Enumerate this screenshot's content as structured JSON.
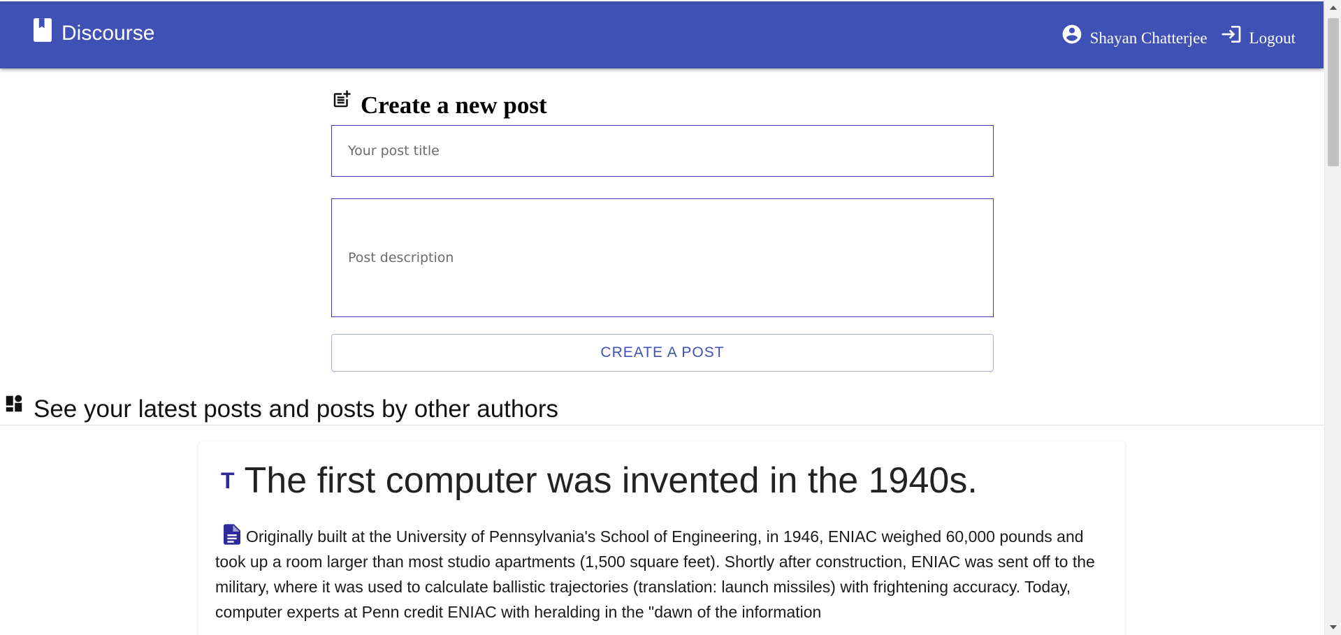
{
  "app": {
    "title": "Discourse"
  },
  "nav": {
    "user_name": "Shayan Chatterjee",
    "logout_label": "Logout"
  },
  "create_post": {
    "heading": "Create a new post",
    "title_placeholder": "Your post title",
    "description_placeholder": "Post description",
    "submit_label": "CREATE A POST"
  },
  "posts_section": {
    "heading": "See your latest posts and posts by other authors"
  },
  "posts": [
    {
      "title_icon": "T",
      "title": "The first computer was invented in the 1940s.",
      "description": "Originally built at the University of Pennsylvania's School of Engineering, in 1946, ENIAC weighed 60,000 pounds and took up a room larger than most studio apartments (1,500 square feet). Shortly after construction, ENIAC was sent off to the military, where it was used to calculate ballistic trajectories (translation: launch missiles) with frightening accuracy. Today, computer experts at Penn credit ENIAC with heralding in the \"dawn of the information"
    }
  ],
  "colors": {
    "primary": "#3f51b5",
    "input_border": "#3f38b1",
    "icon_accent": "#2e2a9a"
  },
  "icons": {
    "brand": "book-icon",
    "user": "account-circle-icon",
    "logout": "login-arrow-icon",
    "create": "post-add-icon",
    "posts": "dashboard-icon",
    "post_title": "title-icon",
    "post_description": "document-icon"
  }
}
